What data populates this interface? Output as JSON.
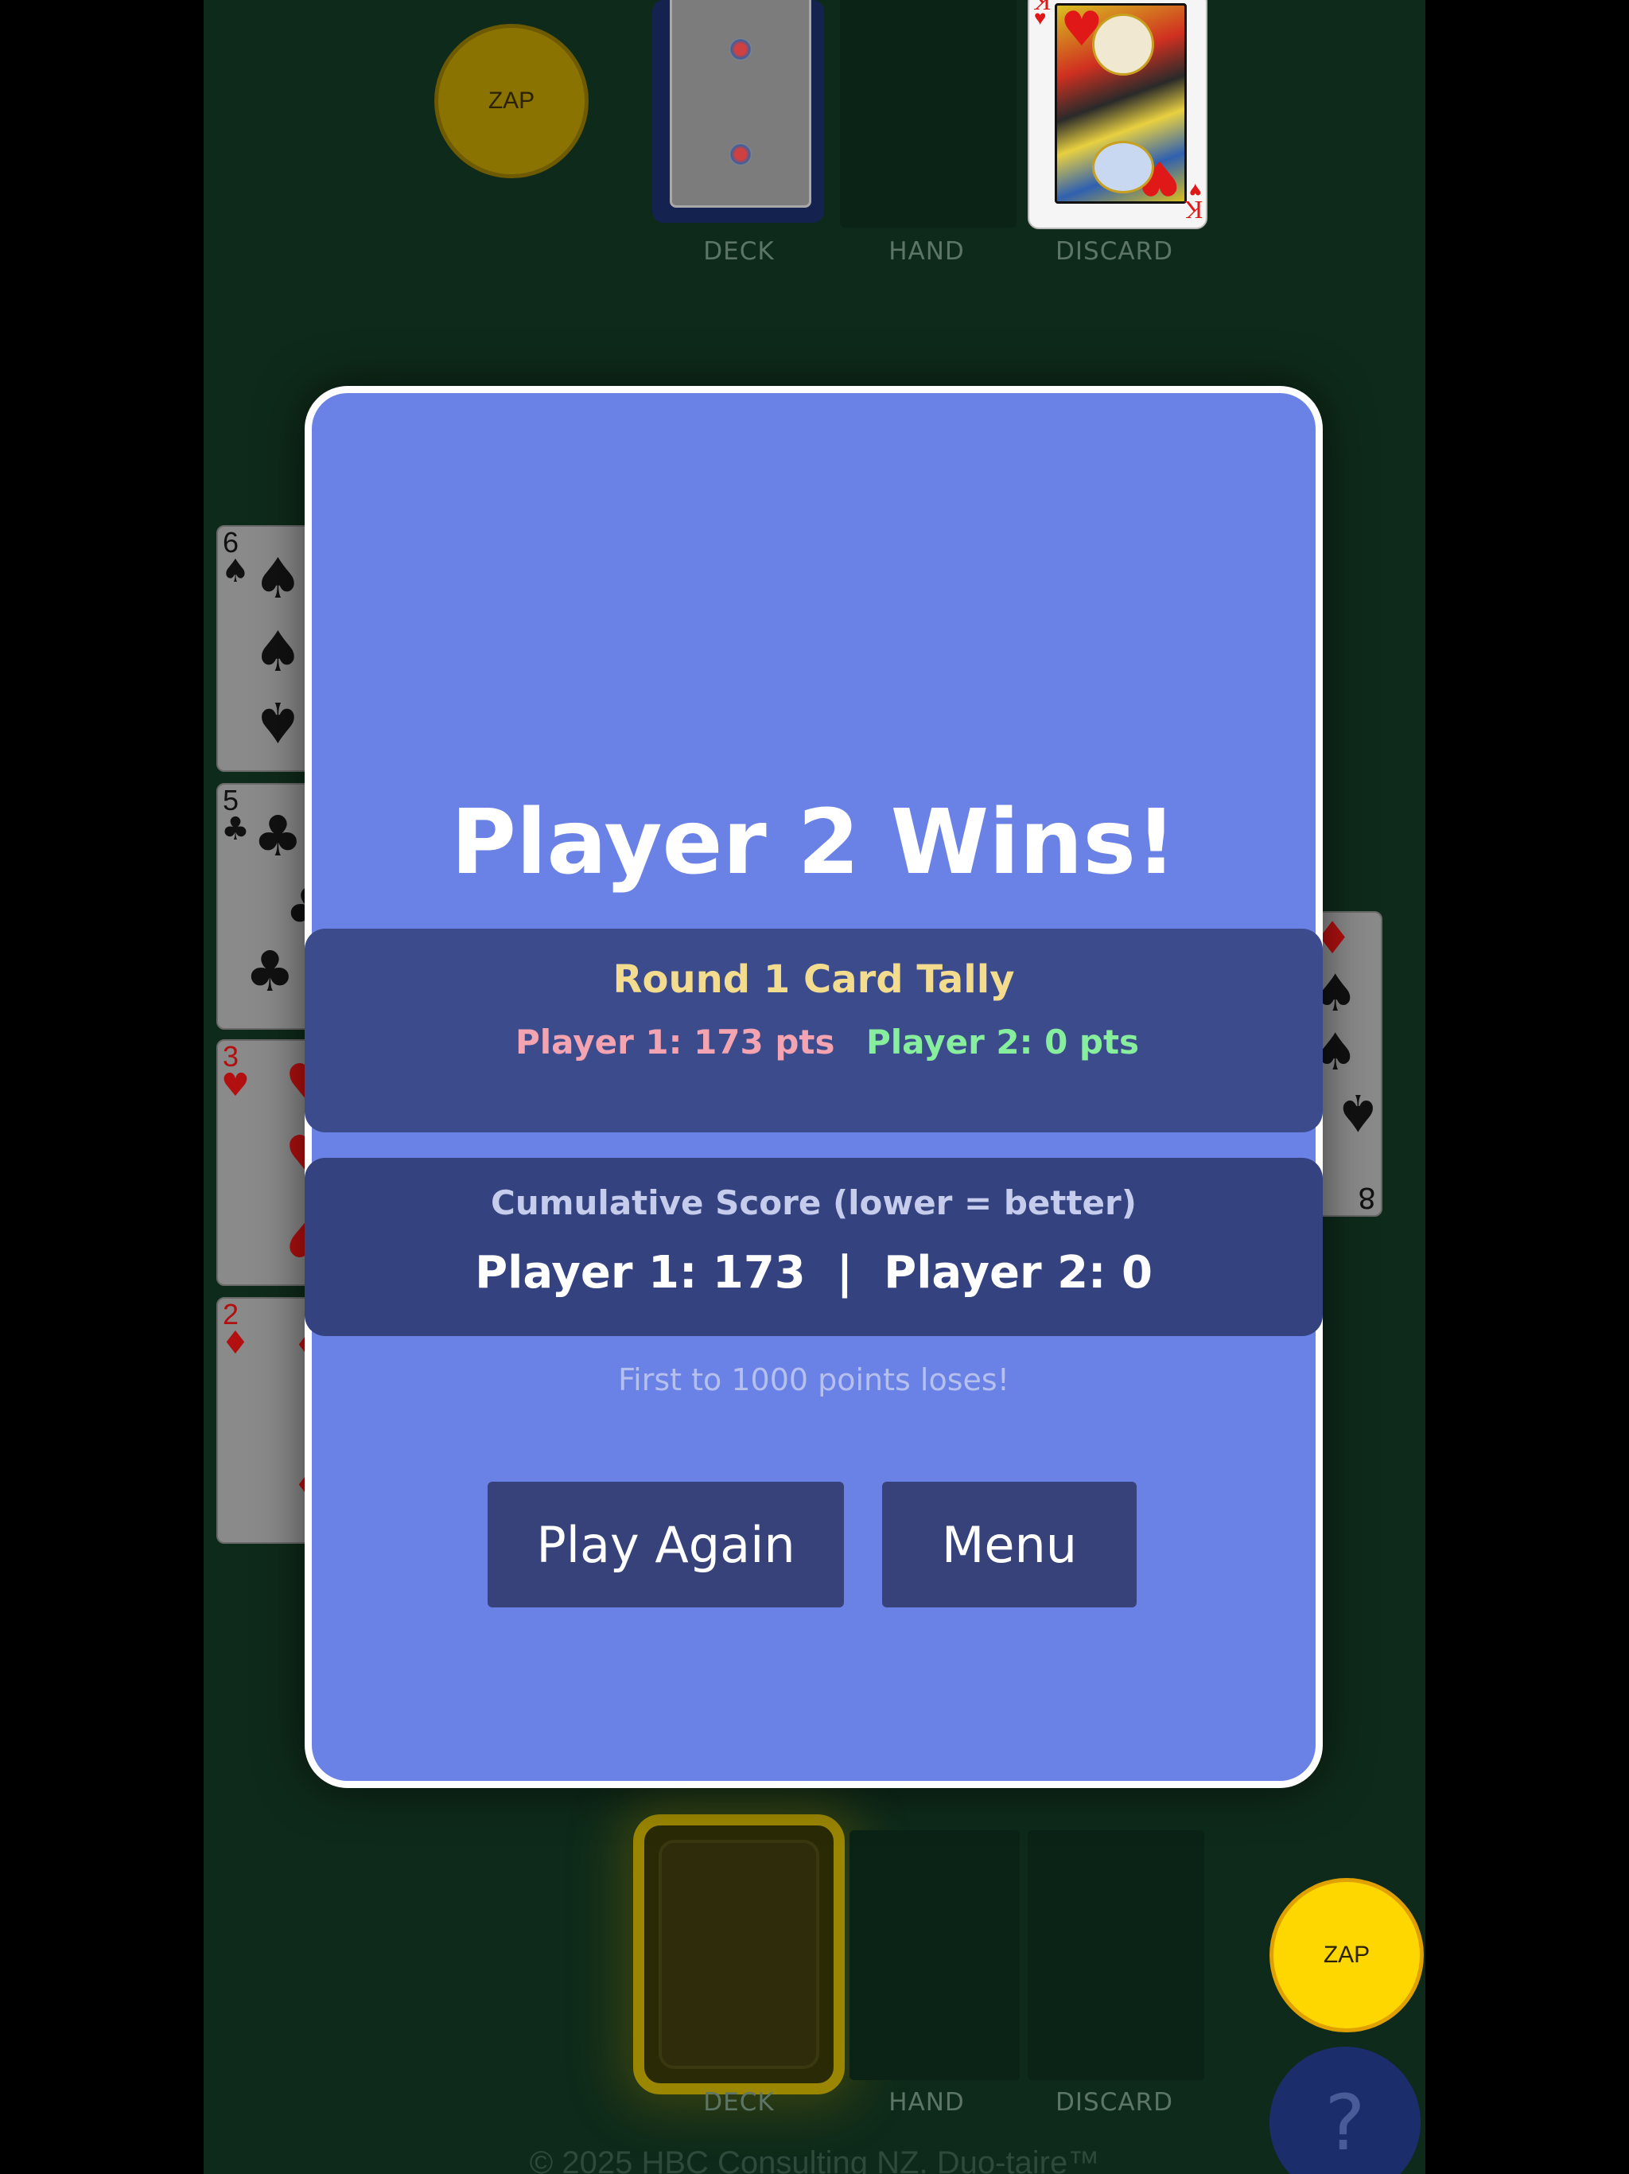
{
  "opponent_area": {
    "zap_label": "ZAP",
    "pile_labels": {
      "deck": "DECK",
      "hand": "HAND",
      "discard": "DISCARD"
    },
    "discard_top_card": {
      "rank": "K",
      "suit": "heart"
    }
  },
  "player_area": {
    "zap_label": "ZAP",
    "pile_labels": {
      "deck": "DECK",
      "hand": "HAND",
      "discard": "DISCARD"
    },
    "help_label": "?"
  },
  "left_column_cards": [
    {
      "rank": "6",
      "suit": "♠",
      "color": "black"
    },
    {
      "rank": "5",
      "suit": "♣",
      "color": "black"
    },
    {
      "rank": "3",
      "suit": "♥",
      "color": "red"
    },
    {
      "rank": "2",
      "suit": "♦",
      "color": "red"
    }
  ],
  "right_column_card": {
    "rank": "8",
    "suit": "♠"
  },
  "modal": {
    "title": "Player 2 Wins!",
    "tally": {
      "heading": "Round 1 Card Tally",
      "player1": "Player 1: 173 pts",
      "player2": "Player 2: 0 pts"
    },
    "cumulative": {
      "heading": "Cumulative Score (lower = better)",
      "scores": "Player 1: 173  |  Player 2: 0"
    },
    "rule": "First to 1000 points loses!",
    "play_again_label": "Play Again",
    "menu_label": "Menu"
  },
  "footer": "© 2025 HBC Consulting NZ. Duo-taire™",
  "colors": {
    "table": "#0e2a1a",
    "modal_bg": "#6a81e6",
    "zap_active": "#ffd700",
    "zap_dim": "#8a7300",
    "tally_p1": "#f4a3b0",
    "tally_p2": "#86ee9c",
    "tally_heading": "#f4dc8e"
  }
}
